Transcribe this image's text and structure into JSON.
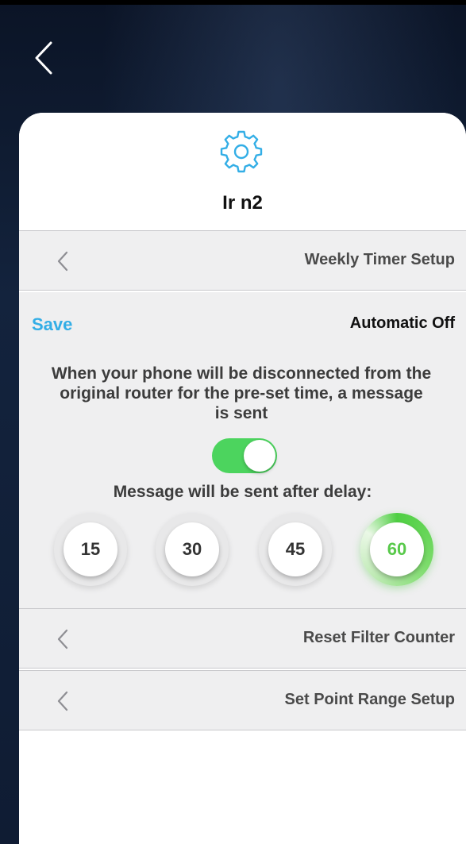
{
  "colors": {
    "accent": "#33aee6",
    "toggle_on": "#4cd45e",
    "selected_option": "#58c94a",
    "row_background": "#efeff0"
  },
  "icons": {
    "back": "chevron-left-icon",
    "header": "gear-icon",
    "row_expand": "chevron-left-icon"
  },
  "device": {
    "name": "Ir n2"
  },
  "rows": {
    "weekly_timer": "Weekly Timer Setup",
    "reset_filter": "Reset Filter Counter",
    "set_point": "Set Point Range Setup"
  },
  "automatic_off": {
    "save_label": "Save",
    "title": "Automatic Off",
    "description": "When your phone will be disconnected from the original router for the pre-set time, a message is sent",
    "toggle_on": true,
    "delay_label": "Message will be sent after delay:",
    "options": [
      "15",
      "30",
      "45",
      "60"
    ],
    "selected": "60"
  }
}
